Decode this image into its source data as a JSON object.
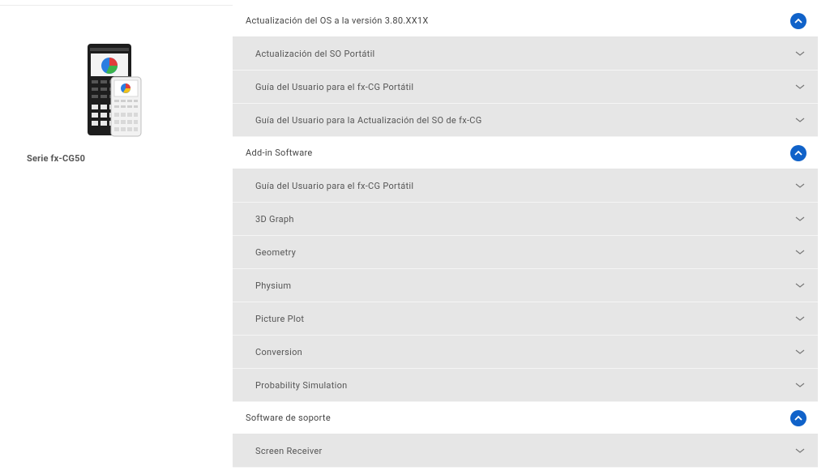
{
  "product": {
    "name": "Serie fx-CG50"
  },
  "sections": [
    {
      "title": "Actualización del OS a la versión 3.80.XX1X",
      "items": [
        "Actualización del SO Portátil",
        "Guía del Usuario para el fx-CG Portátil",
        "Guía del Usuario para la Actualización del SO de fx-CG"
      ]
    },
    {
      "title": "Add-in Software",
      "items": [
        "Guía del Usuario para el fx-CG Portátil",
        "3D Graph",
        "Geometry",
        "Physium",
        "Picture Plot",
        "Conversion",
        "Probability Simulation"
      ]
    },
    {
      "title": "Software de soporte",
      "items": [
        "Screen Receiver"
      ]
    }
  ],
  "icons": {
    "collapse": "chevron-up-icon",
    "expand": "chevron-down-icon"
  },
  "colors": {
    "accent": "#1062c9",
    "row_background": "#e6e6e6",
    "header_background": "#ffffff"
  }
}
